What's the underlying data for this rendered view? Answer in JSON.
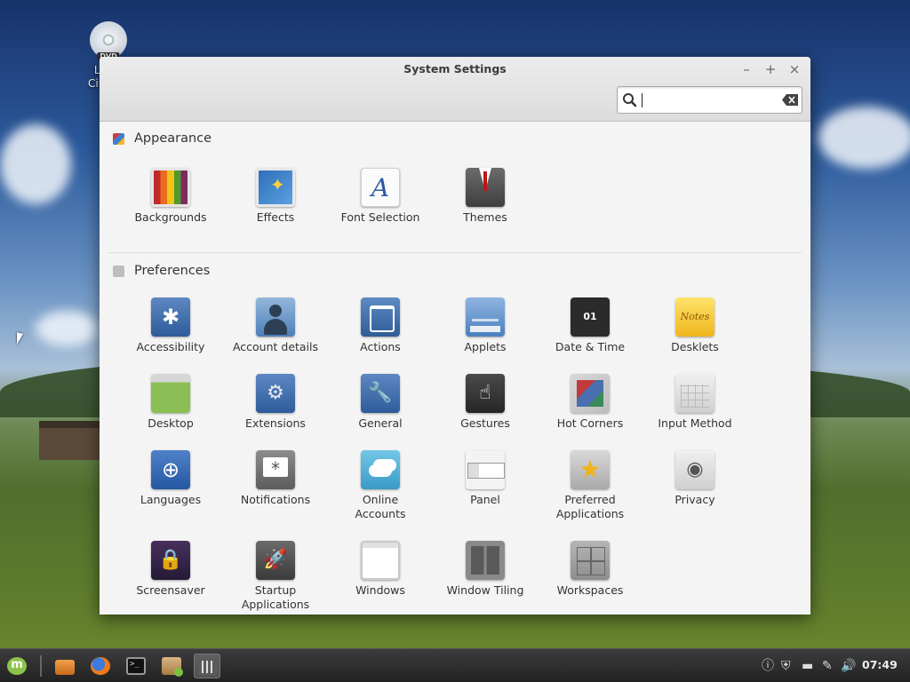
{
  "desktop": {
    "dvd_label": "DVD",
    "icon_line1": "Linux",
    "icon_line2": "Cinnam"
  },
  "window": {
    "title": "System Settings",
    "controls": {
      "minimize": "–",
      "maximize": "+",
      "close": "×"
    },
    "search": {
      "value": "",
      "placeholder": ""
    }
  },
  "sections": {
    "appearance": {
      "title": "Appearance",
      "color": "#cc3333",
      "items": [
        {
          "label": "Backgrounds",
          "icon": "backgrounds-icon"
        },
        {
          "label": "Effects",
          "icon": "effects-icon"
        },
        {
          "label": "Font Selection",
          "icon": "font-selection-icon",
          "glyph": "A"
        },
        {
          "label": "Themes",
          "icon": "themes-icon"
        }
      ]
    },
    "preferences": {
      "title": "Preferences",
      "color": "#b0b0b0",
      "items": [
        {
          "label": "Accessibility",
          "icon": "accessibility-icon",
          "glyph": "✱"
        },
        {
          "label": "Account details",
          "icon": "account-details-icon"
        },
        {
          "label": "Actions",
          "icon": "actions-icon"
        },
        {
          "label": "Applets",
          "icon": "applets-icon"
        },
        {
          "label": "Date & Time",
          "icon": "date-time-icon",
          "glyph": "01"
        },
        {
          "label": "Desklets",
          "icon": "desklets-icon",
          "glyph": "Notes"
        },
        {
          "label": "Desktop",
          "icon": "desktop-icon"
        },
        {
          "label": "Extensions",
          "icon": "extensions-icon",
          "glyph": "⚙"
        },
        {
          "label": "General",
          "icon": "general-icon",
          "glyph": "🔧"
        },
        {
          "label": "Gestures",
          "icon": "gestures-icon",
          "glyph": "☝"
        },
        {
          "label": "Hot Corners",
          "icon": "hot-corners-icon"
        },
        {
          "label": "Input Method",
          "icon": "input-method-icon"
        },
        {
          "label": "Languages",
          "icon": "languages-icon",
          "glyph": "⊕"
        },
        {
          "label": "Notifications",
          "icon": "notifications-icon"
        },
        {
          "label": "Online Accounts",
          "line1": "Online",
          "line2": "Accounts",
          "icon": "online-accounts-icon"
        },
        {
          "label": "Panel",
          "icon": "panel-icon"
        },
        {
          "label": "Preferred Applications",
          "line1": "Preferred",
          "line2": "Applications",
          "icon": "preferred-applications-icon",
          "glyph": "★"
        },
        {
          "label": "Privacy",
          "icon": "privacy-icon",
          "glyph": "◉"
        },
        {
          "label": "Screensaver",
          "icon": "screensaver-icon",
          "glyph": "🔒"
        },
        {
          "label": "Startup Applications",
          "line1": "Startup",
          "line2": "Applications",
          "icon": "startup-applications-icon",
          "glyph": "🚀"
        },
        {
          "label": "Windows",
          "icon": "windows-icon"
        },
        {
          "label": "Window Tiling",
          "icon": "window-tiling-icon"
        },
        {
          "label": "Workspaces",
          "icon": "workspaces-icon"
        }
      ]
    }
  },
  "taskbar": {
    "launchers": [
      "menu-icon",
      "files-icon",
      "firefox-icon",
      "terminal-icon",
      "package-icon",
      "system-settings-icon"
    ],
    "tray": {
      "info": "ⓘ",
      "shield": "⛨",
      "battery": "▬",
      "pen": "✎",
      "volume": "🔊"
    },
    "clock": "07:49"
  }
}
